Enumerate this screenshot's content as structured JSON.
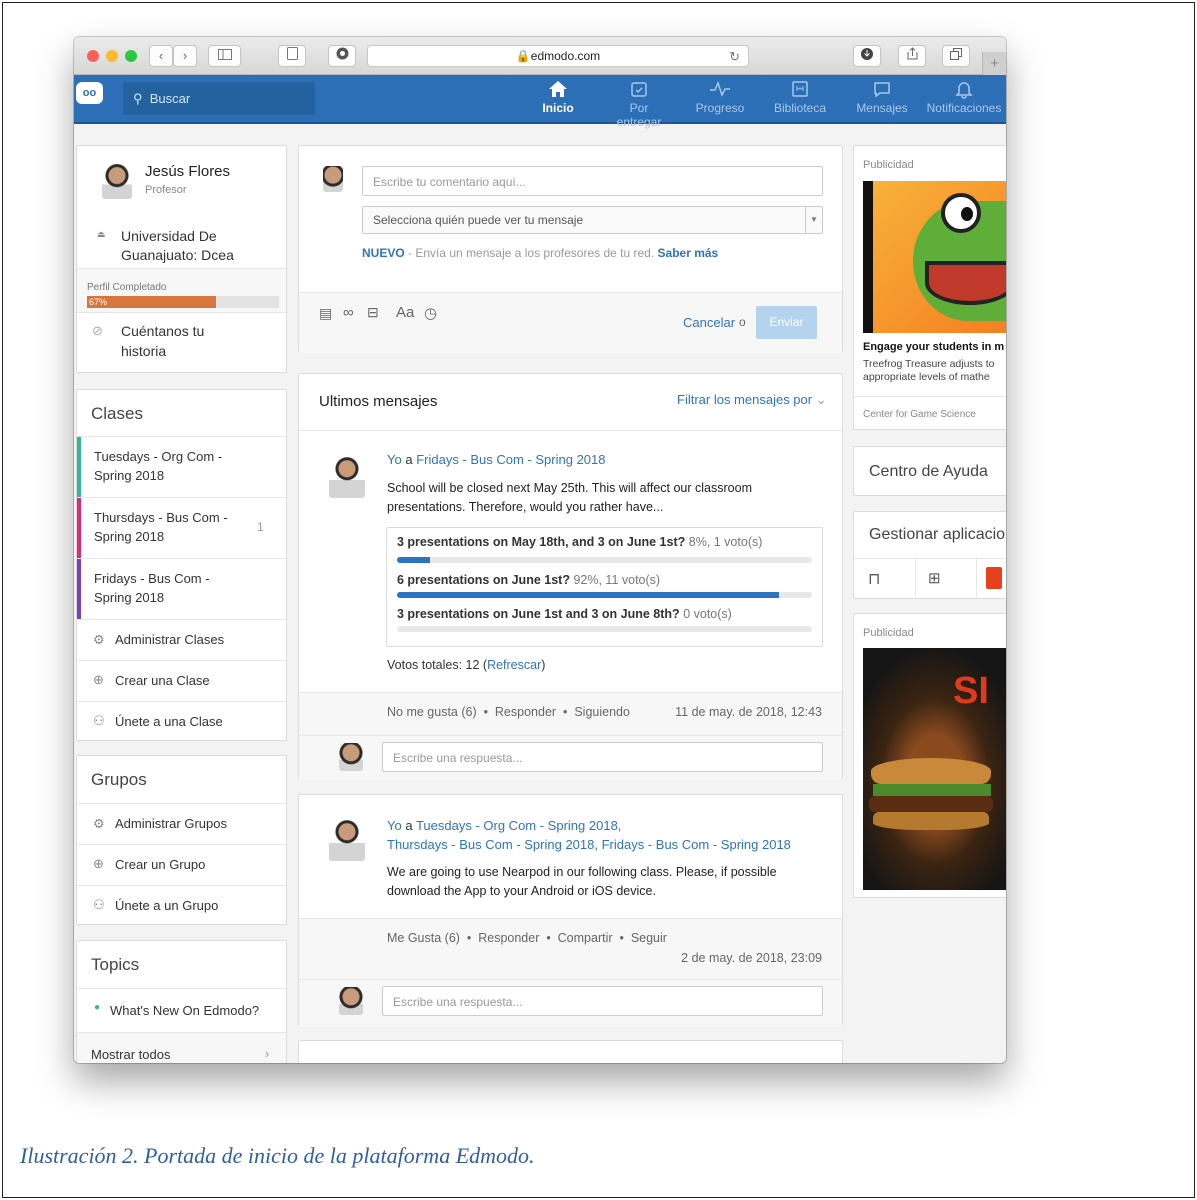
{
  "browser": {
    "url": "edmodo.com",
    "nav_back": "‹",
    "nav_forward": "›"
  },
  "nav": {
    "search_placeholder": "Buscar",
    "items": [
      {
        "label": "Inicio",
        "icon": "home-icon"
      },
      {
        "label": "Por entregar",
        "icon": "assignment-icon"
      },
      {
        "label": "Progreso",
        "icon": "progress-icon"
      },
      {
        "label": "Biblioteca",
        "icon": "library-icon"
      },
      {
        "label": "Mensajes",
        "icon": "messages-icon"
      },
      {
        "label": "Notificaciones",
        "icon": "bell-icon"
      }
    ]
  },
  "profile": {
    "name": "Jesús Flores",
    "role": "Profesor",
    "school": "Universidad De Guanajuato: Dcea",
    "completed_label": "Perfil Completado",
    "completed_pct": "67%",
    "completed_value": 0.67,
    "story": "Cuéntanos tu historia"
  },
  "classes": {
    "title": "Clases",
    "items": [
      {
        "label": "Tuesdays - Org Com - Spring 2018",
        "count": "",
        "color": "#2fb79a"
      },
      {
        "label": "Thursdays - Bus Com - Spring 2018",
        "count": "1",
        "color": "#e0287b"
      },
      {
        "label": "Fridays - Bus Com - Spring 2018",
        "count": "",
        "color": "#7a3fc2"
      }
    ],
    "actions": [
      "Administrar Clases",
      "Crear una Clase",
      "Únete a una Clase"
    ]
  },
  "groups": {
    "title": "Grupos",
    "actions": [
      "Administrar Grupos",
      "Crear un Grupo",
      "Únete a un Grupo"
    ]
  },
  "topics": {
    "title": "Topics",
    "items": [
      "What's New On Edmodo?"
    ],
    "show_all": "Mostrar todos"
  },
  "composer": {
    "comment_placeholder": "Escribe tu comentario aquí...",
    "select_placeholder": "Selecciona quién puede ver tu mensaje",
    "new_label": "NUEVO",
    "new_text": "- Envía un mensaje a los profesores de tu red.",
    "learn_more": "Saber más",
    "cancel": "Cancelar",
    "or": "o",
    "send": "Enviar"
  },
  "feed": {
    "title": "Ultimos mensajes",
    "filter": "Filtrar los mensajes por",
    "post1": {
      "from": "Yo",
      "to_word": "a",
      "to": "Fridays - Bus Com - Spring 2018",
      "text": "School will be closed next May 25th. This will affect our classroom presentations. Therefore, would you rather have...",
      "poll": [
        {
          "option": "3 presentations on May 18th, and 3 on June 1st?",
          "result": "8%, 1 voto(s)",
          "value": 0.08
        },
        {
          "option": "6 presentations on June 1st?",
          "result": "92%, 11 voto(s)",
          "value": 0.92
        },
        {
          "option": "3 presentations on June 1st and 3 on June 8th?",
          "result": "0 voto(s)",
          "value": 0
        }
      ],
      "total": "Votos totales: 12 (",
      "refresh": "Refrescar",
      "total_end": ")",
      "like": "No me gusta (6)",
      "reply": "Responder",
      "follow": "Siguiendo",
      "date": "11 de may. de 2018, 12:43",
      "reply_placeholder": "Escribe una respuesta..."
    },
    "post2": {
      "from": "Yo",
      "to_word": "a",
      "to1": "Tuesdays - Org Com - Spring 2018,",
      "to2": "Thursdays - Bus Com - Spring 2018,",
      "to3": "Fridays - Bus Com - Spring 2018",
      "text": "We are going to use Nearpod in our following class. Please, if possible download the App to your Android or iOS device.",
      "like": "Me Gusta (6)",
      "reply": "Responder",
      "share": "Compartir",
      "follow": "Seguir",
      "date": "2 de may. de 2018, 23:09",
      "reply_placeholder": "Escribe una respuesta..."
    }
  },
  "right": {
    "ad_label": "Publicidad",
    "ad_title": "Engage your students in m",
    "ad_text": "Treefrog Treasure adjusts to appropriate levels of mathe",
    "ad_source": "Center for Game Science",
    "help": "Centro de Ayuda",
    "apps": "Gestionar aplicacio",
    "ad2_label": "Publicidad",
    "ad2_text": "SI"
  },
  "caption": "Ilustración 2. Portada de inicio de la plataforma Edmodo."
}
